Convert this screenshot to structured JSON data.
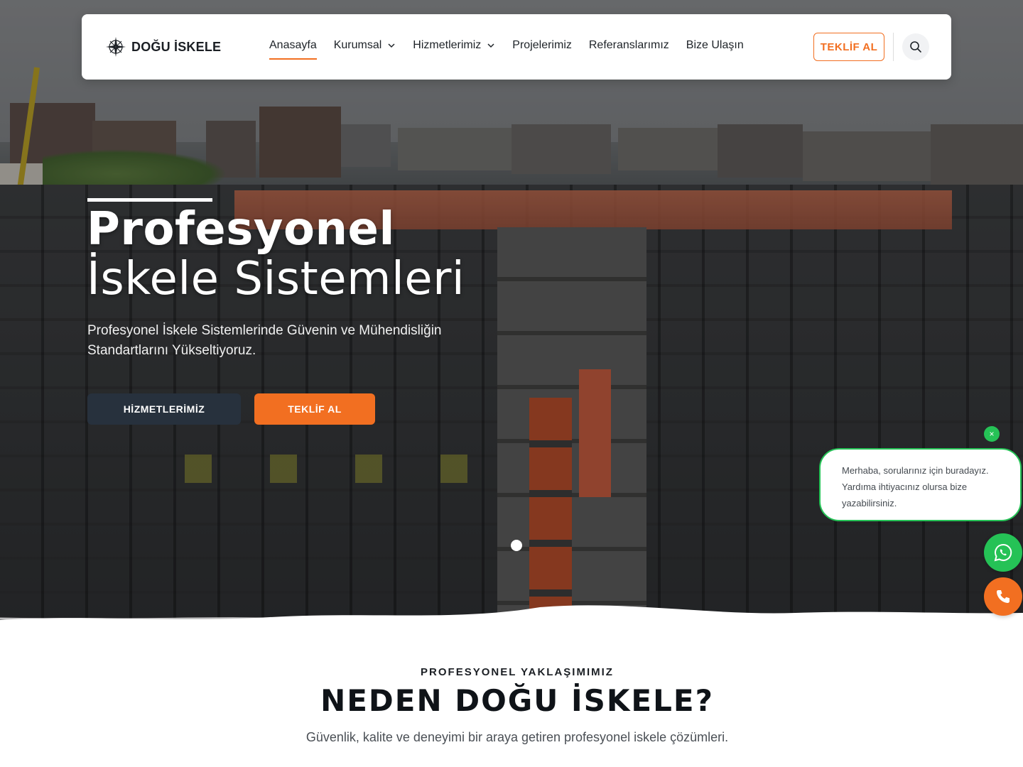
{
  "header": {
    "brand": "DOĞU İSKELE",
    "nav": [
      {
        "label": "Anasayfa",
        "active": true,
        "dropdown": false
      },
      {
        "label": "Kurumsal",
        "active": false,
        "dropdown": true
      },
      {
        "label": "Hizmetlerimiz",
        "active": false,
        "dropdown": true
      },
      {
        "label": "Projelerimiz",
        "active": false,
        "dropdown": false
      },
      {
        "label": "Referanslarımız",
        "active": false,
        "dropdown": false
      },
      {
        "label": "Bize Ulaşın",
        "active": false,
        "dropdown": false
      }
    ],
    "cta_label": "TEKLİF AL",
    "search_icon": "search-icon"
  },
  "hero": {
    "title_line1": "Profesyonel",
    "title_line2": "İskele Sistemleri",
    "subtitle": "Profesyonel İskele Sistemlerinde Güvenin ve Mühendisliğin Standartlarını Yükseltiyoruz.",
    "btn_services": "HİZMETLERİMİZ",
    "btn_quote": "TEKLİF AL"
  },
  "chat": {
    "close_label": "×",
    "lines": [
      "Merhaba, sorularınız için buradayız.",
      "Yardıma ihtiyacınız olursa bize",
      "yazabilirsiniz."
    ]
  },
  "section": {
    "eyebrow": "PROFESYONEL YAKLAŞIMIMIZ",
    "title": "NEDEN DOĞU İSKELE?",
    "subtitle": "Güvenlik, kalite ve deneyimi bir araya getiren profesyonel iskele çözümleri."
  },
  "colors": {
    "accent": "#f26f21",
    "dark_button": "#27313d",
    "whatsapp": "#25c256"
  }
}
